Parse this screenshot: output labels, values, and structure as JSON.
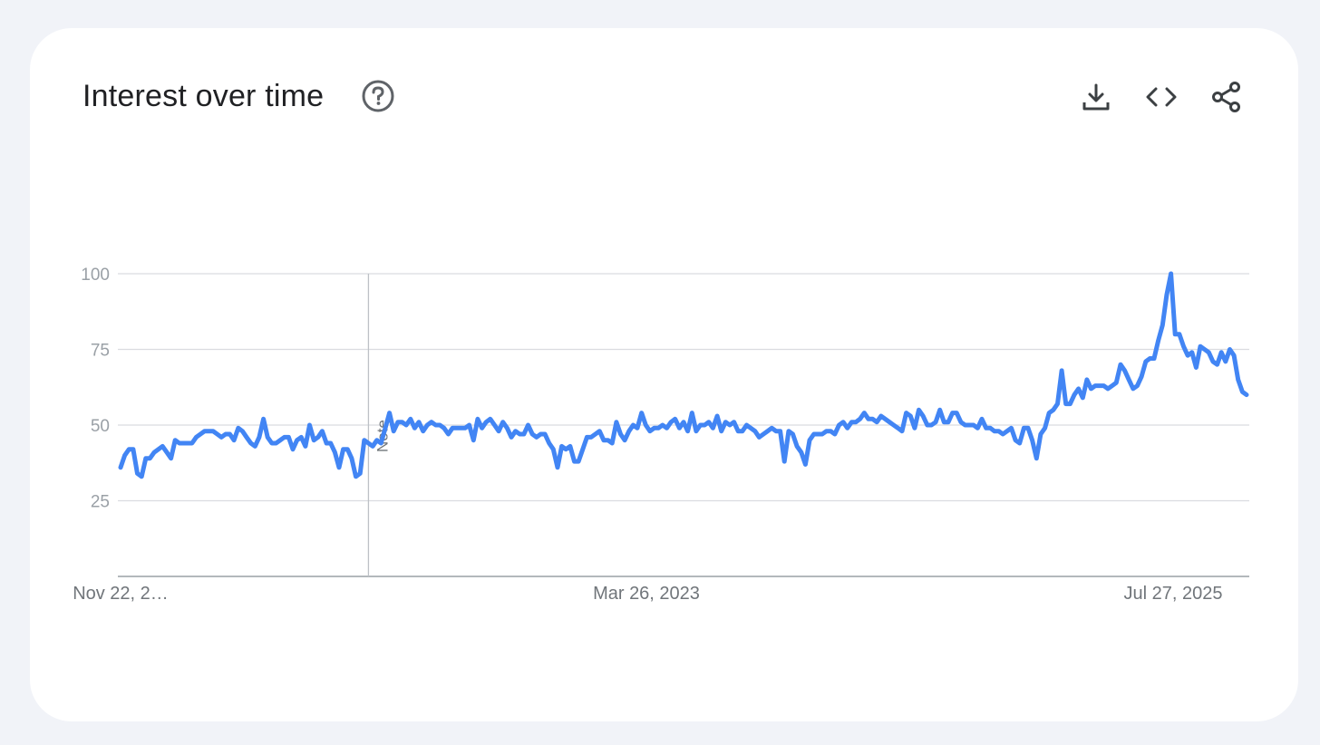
{
  "card": {
    "title": "Interest over time",
    "tools": {
      "download": "download-icon",
      "embed": "code-icon",
      "share": "share-icon",
      "help": "help-circle-icon"
    }
  },
  "colors": {
    "line": "#4285f4",
    "grid": "#dadce0",
    "axis": "#9aa0a6"
  },
  "chart_data": {
    "type": "line",
    "title": "Interest over time",
    "ylim": [
      0,
      100
    ],
    "y_ticks": [
      "25",
      "50",
      "75",
      "100"
    ],
    "x_tick_labels": [
      "Nov 22, 2…",
      "Mar 26, 2023",
      "Jul 27, 2025"
    ],
    "annotations": [
      {
        "label": "Note",
        "index": 59
      }
    ],
    "grid": true,
    "series": [
      {
        "values": [
          36,
          40,
          42,
          42,
          34,
          33,
          39,
          39,
          41,
          42,
          43,
          41,
          39,
          45,
          44,
          44,
          44,
          44,
          46,
          47,
          48,
          48,
          48,
          47,
          46,
          47,
          47,
          45,
          49,
          48,
          46,
          44,
          43,
          46,
          52,
          46,
          44,
          44,
          45,
          46,
          46,
          42,
          45,
          46,
          43,
          50,
          45,
          46,
          48,
          44,
          44,
          41,
          36,
          42,
          42,
          39,
          33,
          34,
          45,
          44,
          43,
          45,
          44,
          49,
          54,
          48,
          51,
          51,
          50,
          52,
          49,
          51,
          48,
          50,
          51,
          50,
          50,
          49,
          47,
          49,
          49,
          49,
          49,
          50,
          45,
          52,
          49,
          51,
          52,
          50,
          48,
          51,
          49,
          46,
          48,
          47,
          47,
          50,
          47,
          46,
          47,
          47,
          44,
          42,
          36,
          43,
          42,
          43,
          38,
          38,
          42,
          46,
          46,
          47,
          48,
          45,
          45,
          44,
          51,
          47,
          45,
          48,
          50,
          49,
          54,
          50,
          48,
          49,
          49,
          50,
          49,
          51,
          52,
          49,
          51,
          48,
          54,
          48,
          50,
          50,
          51,
          49,
          53,
          48,
          51,
          50,
          51,
          48,
          48,
          50,
          49,
          48,
          46,
          47,
          48,
          49,
          48,
          48,
          38,
          48,
          47,
          43,
          41,
          37,
          45,
          47,
          47,
          47,
          48,
          48,
          47,
          50,
          51,
          49,
          51,
          51,
          52,
          54,
          52,
          52,
          51,
          53,
          52,
          51,
          50,
          49,
          48,
          54,
          53,
          49,
          55,
          53,
          50,
          50,
          51,
          55,
          51,
          51,
          54,
          54,
          51,
          50,
          50,
          50,
          49,
          52,
          49,
          49,
          48,
          48,
          47,
          48,
          49,
          45,
          44,
          49,
          49,
          45,
          39,
          47,
          49,
          54,
          55,
          57,
          68,
          57,
          57,
          60,
          62,
          59,
          65,
          62,
          63,
          63,
          63,
          62,
          63,
          64,
          70,
          68,
          65,
          62,
          63,
          66,
          71,
          72,
          72,
          78,
          83,
          93,
          100,
          80,
          80,
          76,
          73,
          74,
          69,
          76,
          75,
          74,
          71,
          70,
          74,
          71,
          75,
          73,
          65,
          61,
          60
        ]
      }
    ]
  }
}
